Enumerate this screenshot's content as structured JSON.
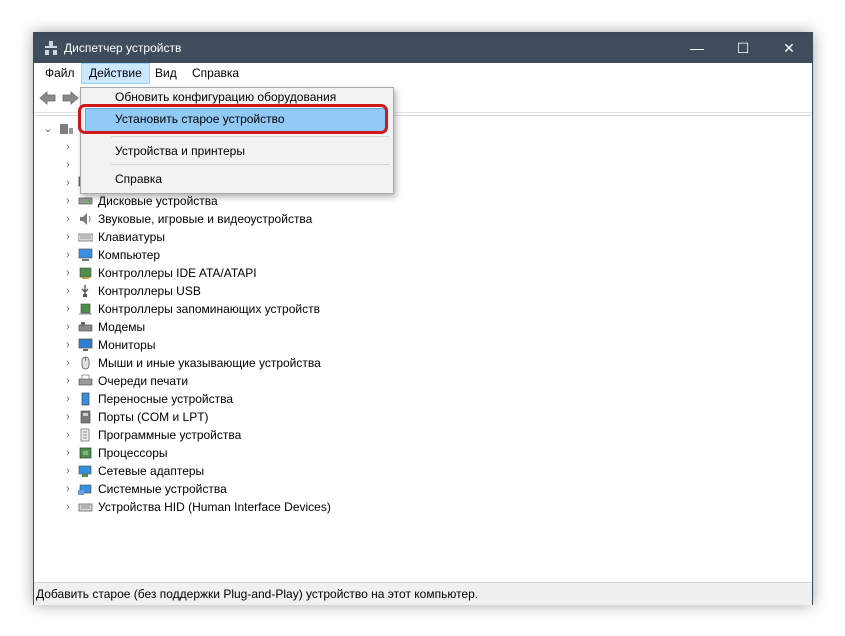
{
  "window": {
    "title": "Диспетчер устройств",
    "minimize": "—",
    "maximize": "☐",
    "close": "✕"
  },
  "menubar": {
    "items": [
      "Файл",
      "Действие",
      "Вид",
      "Справка"
    ],
    "active": "Действие"
  },
  "dropdown": {
    "items": [
      {
        "label": "Обновить конфигурацию оборудования"
      },
      {
        "label": "Установить старое устройство",
        "highlighted": true
      },
      {
        "label": "Устройства и принтеры"
      },
      {
        "label": "Справка"
      }
    ]
  },
  "tree": {
    "root_label": "",
    "categories": [
      {
        "label": "",
        "icon": "generic-device-icon"
      },
      {
        "label": "",
        "icon": "generic-device-icon"
      },
      {
        "label": "",
        "icon": "monitor-icon"
      },
      {
        "label": "Дисковые устройства",
        "icon": "disk-drive-icon"
      },
      {
        "label": "Звуковые, игровые и видеоустройства",
        "icon": "speaker-icon"
      },
      {
        "label": "Клавиатуры",
        "icon": "keyboard-icon"
      },
      {
        "label": "Компьютер",
        "icon": "computer-icon"
      },
      {
        "label": "Контроллеры IDE ATA/ATAPI",
        "icon": "ide-controller-icon"
      },
      {
        "label": "Контроллеры USB",
        "icon": "usb-icon"
      },
      {
        "label": "Контроллеры запоминающих устройств",
        "icon": "storage-controller-icon"
      },
      {
        "label": "Модемы",
        "icon": "modem-icon"
      },
      {
        "label": "Мониторы",
        "icon": "monitor-icon"
      },
      {
        "label": "Мыши и иные указывающие устройства",
        "icon": "mouse-icon"
      },
      {
        "label": "Очереди печати",
        "icon": "printer-icon"
      },
      {
        "label": "Переносные устройства",
        "icon": "portable-device-icon"
      },
      {
        "label": "Порты (COM и LPT)",
        "icon": "port-icon"
      },
      {
        "label": "Программные устройства",
        "icon": "software-device-icon"
      },
      {
        "label": "Процессоры",
        "icon": "processor-icon"
      },
      {
        "label": "Сетевые адаптеры",
        "icon": "network-adapter-icon"
      },
      {
        "label": "Системные устройства",
        "icon": "system-device-icon"
      },
      {
        "label": "Устройства HID (Human Interface Devices)",
        "icon": "hid-icon"
      }
    ]
  },
  "statusbar": {
    "text": "Добавить старое (без поддержки Plug-and-Play) устройство на этот компьютер."
  },
  "colors": {
    "titlebar": "#3f4c5c",
    "highlight": "#91c9f7",
    "annotation_ring": "#d11818",
    "menu_active": "#cce8ff"
  }
}
